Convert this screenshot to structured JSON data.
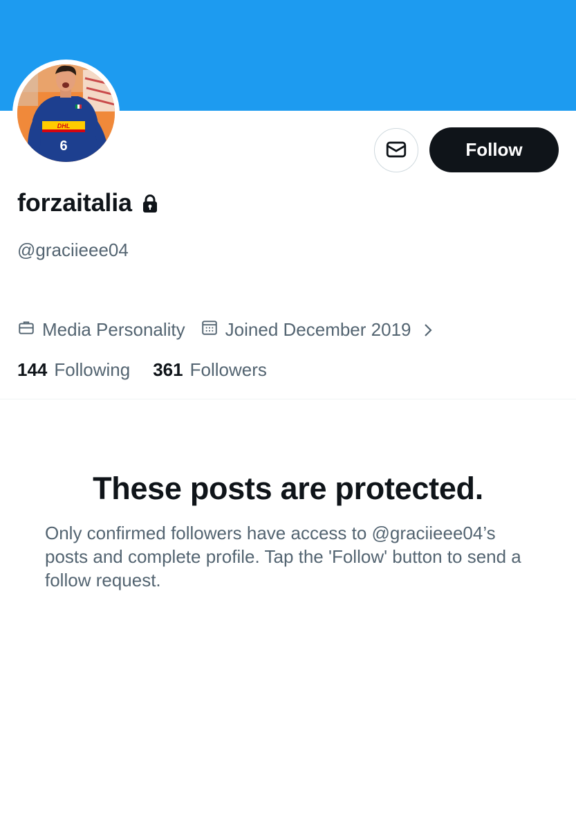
{
  "theme": {
    "banner_color": "#1d9bf0",
    "text_primary": "#0f1419",
    "text_secondary": "#536471",
    "follow_button_bg": "#0f1419",
    "divider_color": "#eff3f4"
  },
  "header": {
    "banner": "solid-blue-banner",
    "avatar": "profile-photo-volleyball-player"
  },
  "actions": {
    "message_icon": "envelope-icon",
    "follow_label": "Follow"
  },
  "profile": {
    "display_name": "forzaitalia",
    "protected_icon": "lock-icon",
    "handle": "@graciieee04",
    "category": "Media Personality",
    "category_icon": "briefcase-icon",
    "joined": "Joined December 2019",
    "joined_icon": "calendar-icon",
    "expand_icon": "chevron-right-icon"
  },
  "stats": {
    "following_count": "144",
    "following_label": "Following",
    "followers_count": "361",
    "followers_label": "Followers"
  },
  "protected_notice": {
    "title": "These posts are protected.",
    "body": "Only confirmed followers have access to @graciieee04’s posts and complete profile. Tap the 'Follow' button to send a follow request."
  }
}
